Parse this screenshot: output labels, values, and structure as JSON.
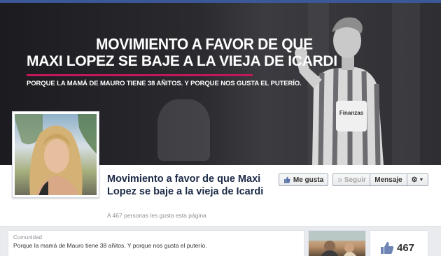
{
  "cover": {
    "headline_1": "MOVIMIENTO A FAVOR DE QUE",
    "headline_2": "MAXI LOPEZ SE BAJE A LA VIEJA DE ICARDI",
    "subline": "PORQUE LA MAMÁ DE MAURO TIENE 38 AÑITOS. Y PORQUE NOS GUSTA EL PUTERÍO.",
    "accent_color": "#c2185b",
    "jersey_text": "Finanzas"
  },
  "page": {
    "title": "Movimiento a favor de que Maxi Lopez se baje a la vieja de Icardi",
    "likes_text": "A 467 personas les gusta esta página"
  },
  "actions": {
    "like_label": "Me gusta",
    "follow_label": "Seguir",
    "message_label": "Mensaje"
  },
  "about": {
    "category": "Comunidad",
    "description": "Porque la mamá de Mauro tiene 38 añitos. Y porque nos gusta el puterío."
  },
  "likebox": {
    "count": "467",
    "icon": "thumbs-up-icon"
  },
  "colors": {
    "facebook_blue": "#3b5998",
    "title_color": "#1c2a47"
  }
}
